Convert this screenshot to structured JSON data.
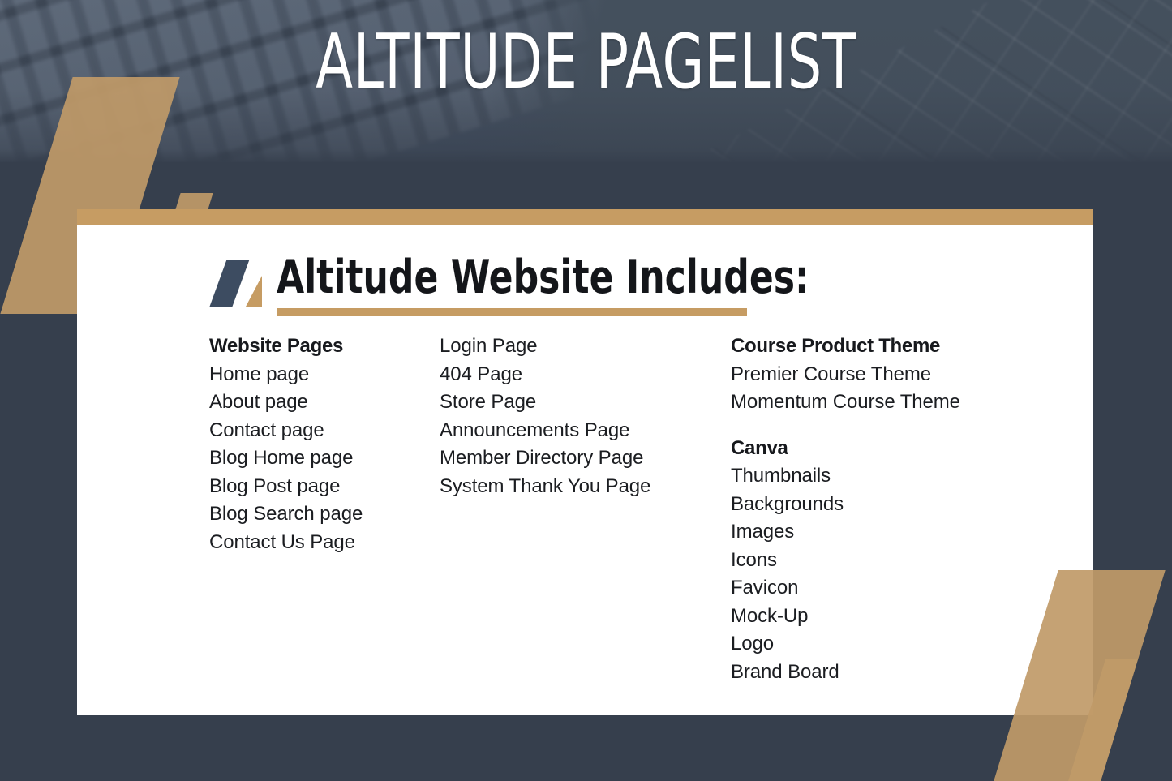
{
  "poster": {
    "title": "ALTITUDE PAGELIST",
    "heading": "Altitude Website Includes:",
    "colors": {
      "navy": "#363f4d",
      "gold": "#c69c63",
      "logo_navy": "#3d4c61",
      "card": "#ffffff",
      "text": "#17191d"
    }
  },
  "columns": {
    "col1": {
      "groups": [
        {
          "title": "Website Pages",
          "items": [
            "Home page",
            "About page",
            "Contact page",
            "Blog Home page",
            "Blog Post page",
            "Blog Search page",
            "Contact Us Page"
          ]
        }
      ]
    },
    "col2": {
      "groups": [
        {
          "title": "",
          "items": [
            "Login Page",
            "404 Page",
            "Store Page",
            "Announcements Page",
            "Member Directory Page",
            "System Thank You Page"
          ]
        }
      ]
    },
    "col3": {
      "groups": [
        {
          "title": "Course Product Theme",
          "items": [
            "Premier Course Theme",
            "Momentum Course Theme"
          ]
        },
        {
          "title": "Canva",
          "items": [
            "Thumbnails",
            "Backgrounds",
            "Images",
            "Icons",
            "Favicon",
            "Mock-Up",
            "Logo",
            "Brand Board"
          ]
        }
      ]
    }
  }
}
